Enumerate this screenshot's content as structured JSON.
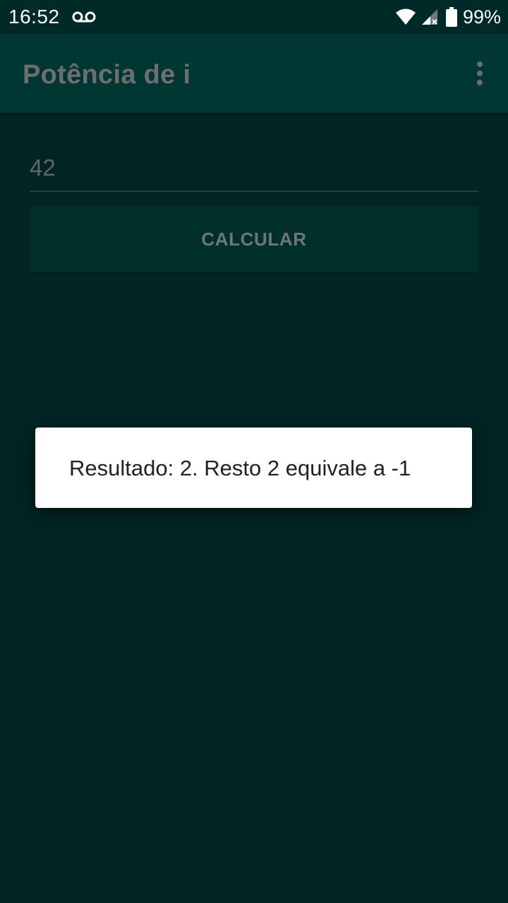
{
  "status_bar": {
    "time": "16:52",
    "battery_percent": "99%",
    "icons": [
      "voicemail-icon",
      "wifi-icon",
      "signal-icon",
      "battery-icon"
    ]
  },
  "toolbar": {
    "title": "Potência de i",
    "menu_icon": "overflow-menu-icon"
  },
  "form": {
    "input_value": "42",
    "button_label": "CALCULAR"
  },
  "toast": {
    "message": "Resultado: 2. Resto 2 equivale a -1"
  },
  "colors": {
    "background": "#002524",
    "toolbar": "#003733",
    "status_bar": "#002a28",
    "button": "#002f2c",
    "toast": "#ffffff"
  }
}
